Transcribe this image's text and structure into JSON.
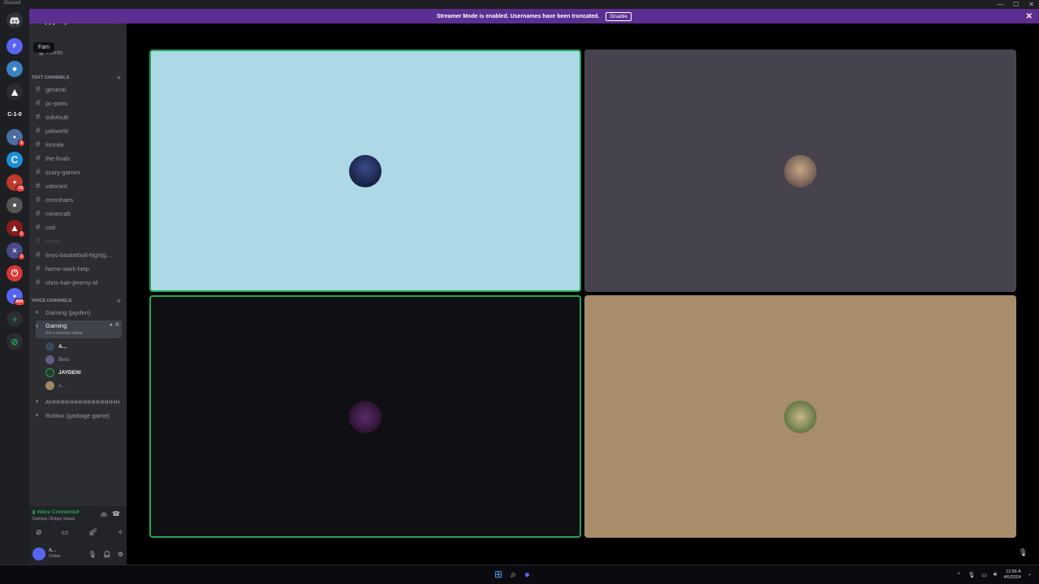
{
  "window": {
    "app_title": "Discord",
    "controls": [
      "—",
      "☐",
      "✕"
    ]
  },
  "servers": [
    {
      "icon": "discord-home-icon",
      "label": "",
      "color": "#2b2d31"
    },
    {
      "icon": "server-fam-icon",
      "label": "F",
      "color": "#5865f2",
      "tooltip": "Fam"
    },
    {
      "icon": "server-diamond-icon",
      "label": "",
      "color": "#3b82c4"
    },
    {
      "icon": "server-triangle-icon",
      "label": "",
      "color": "#2b2d31"
    },
    {
      "icon": "server-c10-icon",
      "label": "C-1-0",
      "color": "#2b2d31"
    },
    {
      "icon": "server-globe-icon",
      "label": "",
      "color": "#4a6fa5",
      "badge": "1"
    },
    {
      "icon": "server-c-icon",
      "label": "C",
      "color": "#1a8fe0"
    },
    {
      "icon": "server-shield-icon",
      "label": "",
      "color": "#c0392b",
      "badge": "75"
    },
    {
      "icon": "server-anime-icon",
      "label": "",
      "color": "#555"
    },
    {
      "icon": "server-apex-icon",
      "label": "",
      "color": "#8b1a1a",
      "badge": "1"
    },
    {
      "icon": "server-sword-icon",
      "label": "",
      "color": "#4a4a8a",
      "badge": "1"
    },
    {
      "icon": "server-power-icon",
      "label": "⏻",
      "color": "#d93636"
    },
    {
      "icon": "server-dm-icon",
      "label": "",
      "color": "#5865f2",
      "badge": "434"
    },
    {
      "icon": "add-server-icon",
      "label": "+",
      "color": "#2b2d31"
    },
    {
      "icon": "explore-icon",
      "label": "",
      "color": "#2b2d31"
    }
  ],
  "sidebar": {
    "guild_name": "Drippy Squad",
    "tooltip": "Fam",
    "events_label": "events",
    "text_category": "TEXT CHANNELS",
    "text_channels": [
      "general",
      "pc-parts",
      "sub4sub",
      "palworld",
      "fortnite",
      "the-finals",
      "scary-games",
      "valorant",
      "crosshairs",
      "minecraft",
      "cod",
      "music",
      "tinys-basketball-high(g...",
      "home-work-help",
      "chris-hair-jeremy-id"
    ],
    "voice_category": "VOICE CHANNELS",
    "voice_channels": {
      "first": "Gaming (jayden)",
      "active": "Gaming",
      "active_status": "Set a channel status",
      "users": [
        {
          "name": "A...",
          "bold": true,
          "color": "#3a4a5a"
        },
        {
          "name": "Beto",
          "bold": false,
          "color": "#6a5a8a"
        },
        {
          "name": "JAYDEN!",
          "bold": true,
          "color": "#2a3a2a"
        },
        {
          "name": "s...",
          "bold": false,
          "color": "#a08860"
        }
      ],
      "after": [
        "AHHHHHHHHHHHHHHHH",
        "Roblox (garbage game)"
      ]
    }
  },
  "voice_panel": {
    "status": "Voice Connected",
    "location": "Gaming / Drippy Squad",
    "username": "A...",
    "presence": "Online"
  },
  "banner": {
    "message": "Streamer Mode is enabled. Usernames have been truncated.",
    "button": "Disable"
  },
  "tiles": [
    {
      "bg": "#add8e6",
      "speaking": true,
      "avatar": "#1a2040"
    },
    {
      "bg": "#46434f",
      "speaking": false,
      "avatar": "#7a6a5a"
    },
    {
      "bg": "#0f0f14",
      "speaking": true,
      "avatar": "#3a1a3a"
    },
    {
      "bg": "#a88d6a",
      "speaking": false,
      "avatar": "#6a7a4a"
    }
  ],
  "taskbar": {
    "time": "12:56 A",
    "date": "4/6/2024"
  }
}
